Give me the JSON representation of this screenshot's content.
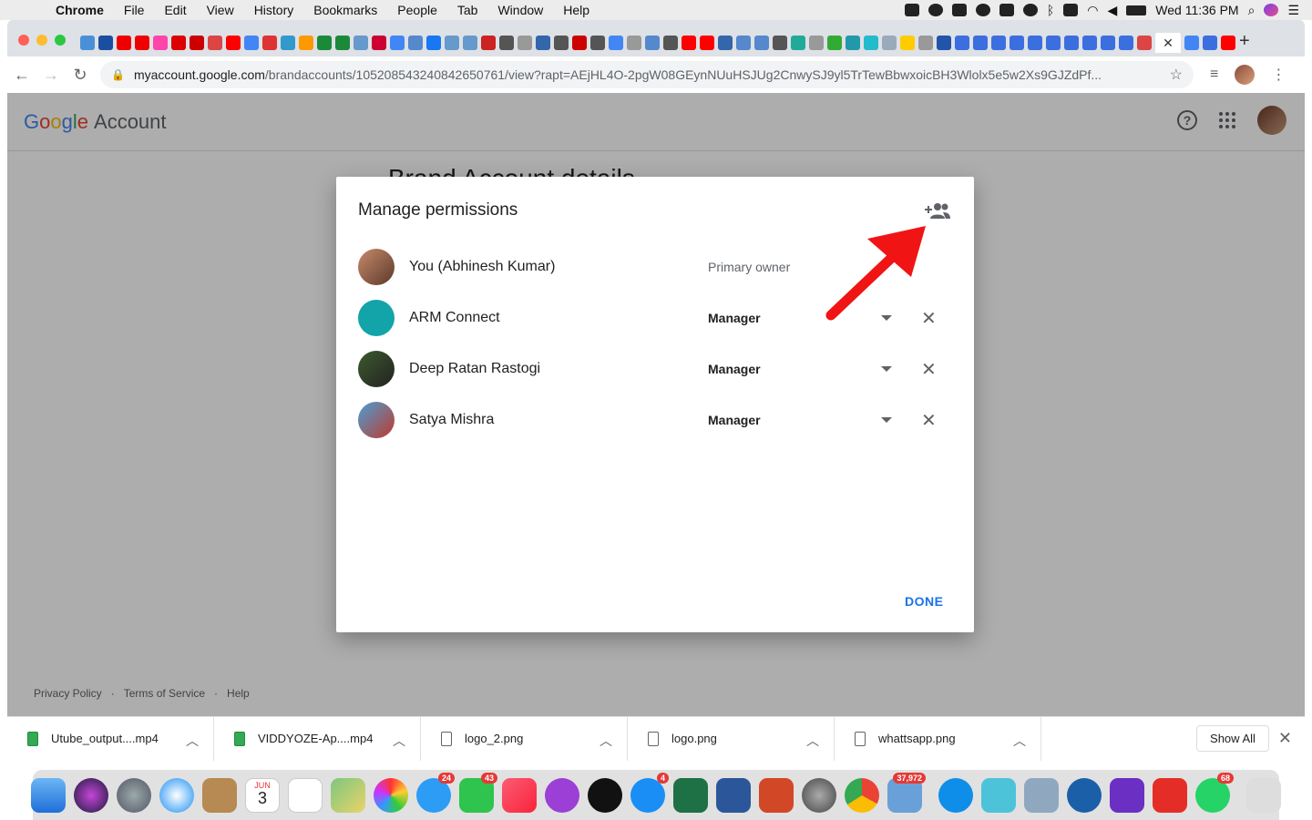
{
  "menubar": {
    "app": "Chrome",
    "items": [
      "File",
      "Edit",
      "View",
      "History",
      "Bookmarks",
      "People",
      "Tab",
      "Window",
      "Help"
    ],
    "clock": "Wed 11:36 PM"
  },
  "browser": {
    "url_host": "myaccount.google.com",
    "url_path": "/brandaccounts/105208543240842650761/view?rapt=AEjHL4O-2pgW08GEynNUuHSJUg2CnwySJ9yl5TrTewBbwxoicBH3Wlolx5e5w2Xs9GJZdPf..."
  },
  "page": {
    "logo_letters": [
      "G",
      "o",
      "o",
      "g",
      "l",
      "e"
    ],
    "logo_suffix": "Account",
    "subtitle": "Brand Account details",
    "footer": [
      "Privacy Policy",
      "Terms of Service",
      "Help"
    ]
  },
  "dialog": {
    "title": "Manage permissions",
    "rows": [
      {
        "name": "You (Abhinesh Kumar)",
        "role": "Primary owner"
      },
      {
        "name": "ARM Connect",
        "role": "Manager"
      },
      {
        "name": "Deep Ratan Rastogi",
        "role": "Manager"
      },
      {
        "name": "Satya Mishra",
        "role": "Manager"
      }
    ],
    "done_label": "DONE"
  },
  "downloads": {
    "items": [
      {
        "name": "Utube_output....mp4",
        "icon": "sheet-icon"
      },
      {
        "name": "VIDDYOZE-Ap....mp4",
        "icon": "sheet-icon"
      },
      {
        "name": "logo_2.png",
        "icon": "file-icon"
      },
      {
        "name": "logo.png",
        "icon": "file-icon"
      },
      {
        "name": "whattsapp.png",
        "icon": "file-icon"
      }
    ],
    "show_all": "Show All"
  },
  "dock": {
    "badges": {
      "messages": "24",
      "facetime": "43",
      "appstore": "4",
      "preview": "37,972",
      "whatsapp": "68"
    },
    "calendar_month": "JUN",
    "calendar_day": "3"
  }
}
